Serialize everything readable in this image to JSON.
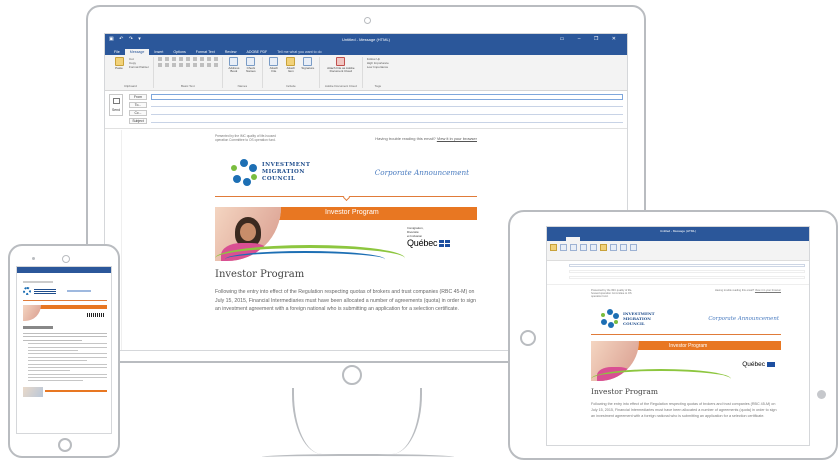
{
  "outlook": {
    "window_title": "Untitled - Message (HTML)",
    "tabs": [
      {
        "label": "File"
      },
      {
        "label": "Message"
      },
      {
        "label": "Insert"
      },
      {
        "label": "Options"
      },
      {
        "label": "Format Text"
      },
      {
        "label": "Review"
      },
      {
        "label": "ADOBE PDF"
      }
    ],
    "tell_me": "Tell me what you want to do",
    "ribbon": {
      "paste_label": "Paste",
      "clipboard_items": [
        "Cut",
        "Copy",
        "Format Painter"
      ],
      "clipboard_group": "Clipboard",
      "basic_text_group": "Basic Text",
      "names_cmds": [
        "Address Book",
        "Check Names"
      ],
      "names_group": "Names",
      "include_cmds": [
        "Attach File",
        "Attach Item",
        "Signature"
      ],
      "include_group": "Include",
      "adobe_cmd": "Attach File as Adobe Document Cloud",
      "adobe_group": "Adobe Document Cloud",
      "tags_items": [
        "Follow Up",
        "High Importance",
        "Low Importance"
      ],
      "tags_group": "Tags"
    },
    "compose": {
      "send_label": "Send",
      "from_label": "From",
      "to_label": "To...",
      "cc_label": "Cc...",
      "subject_label": "Subject"
    }
  },
  "newsletter": {
    "preheader": "Presented by the IMC quality of life-housed operation Committee to OS operation fund.",
    "trouble_text": "Having trouble reading this email?",
    "trouble_link": "View it in your browser",
    "org_name": [
      "INVESTMENT",
      "MIGRATION",
      "COUNCIL"
    ],
    "announcement": "Corporate Announcement",
    "banner_label": "Investor Program",
    "quebec_small": [
      "Immigration,",
      "Diversité",
      "et Inclusion"
    ],
    "quebec_word": "Québec",
    "heading": "Investor Program",
    "paragraph": "Following the entry into effect of the Regulation respecting quotas of brokers and trust companies (RBC 45-M) on July 15, 2015, Financial Intermediaries must have been allocated a number of agreements (quota) in order to sign an investment agreement with a foreign national who is submitting an application for a selection certificate."
  },
  "colors": {
    "outlook_blue": "#2b579a",
    "brand_blue": "#1f4d8c",
    "accent_orange": "#e87722",
    "accent_green": "#8dc63f",
    "device_frame": "#b9bcc0"
  }
}
